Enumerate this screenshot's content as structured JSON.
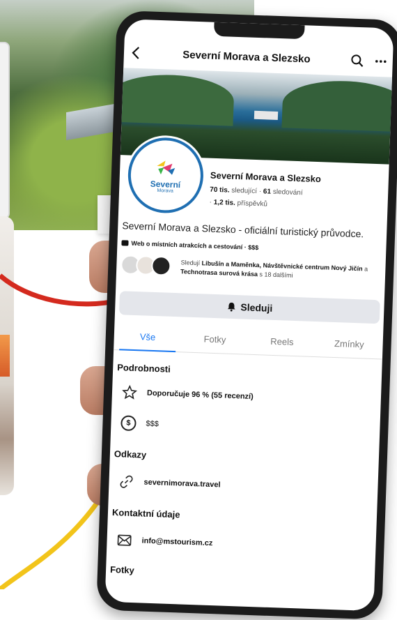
{
  "topbar": {
    "title": "Severní Morava a Slezsko",
    "back_icon": "chevron-left-icon",
    "search_icon": "search-icon",
    "more_icon": "ellipsis-icon"
  },
  "profile": {
    "logo_text": "Severní",
    "logo_subtext": "Morava",
    "name": "Severní Morava a Slezsko",
    "followers_count": "70 tis.",
    "followers_label": "sledující",
    "following_count": "61",
    "following_label": "sledování",
    "posts_count": "1,2 tis.",
    "posts_label": "příspěvků",
    "description": "Severní Morava a Slezsko - oficiální turistický průvodce.",
    "category": "Web o místních atrakcích a cestování · $$$",
    "followed_prefix": "Sledují",
    "followed_names_1": "Libušín a Maměnka, Návštěvnické centrum Nový Jičín",
    "followed_and": "a",
    "followed_names_2": "Technotrasa surová krása",
    "followed_suffix": "s 18 dalšími",
    "follow_button": "Sleduji"
  },
  "tabs": [
    {
      "label": "Vše",
      "active": true
    },
    {
      "label": "Fotky",
      "active": false
    },
    {
      "label": "Reels",
      "active": false
    },
    {
      "label": "Zmínky",
      "active": false
    }
  ],
  "details": {
    "heading": "Podrobnosti",
    "rating": "Doporučuje 96 % (55 recenzí)",
    "price": "$$$"
  },
  "links": {
    "heading": "Odkazy",
    "website": "severnimorava.travel"
  },
  "contact": {
    "heading": "Kontaktní údaje",
    "email": "info@mstourism.cz"
  },
  "photos": {
    "heading": "Fotky"
  },
  "colors": {
    "accent": "#1877f2",
    "logo_blue": "#1f6fb2",
    "button_bg": "#e4e6eb"
  }
}
